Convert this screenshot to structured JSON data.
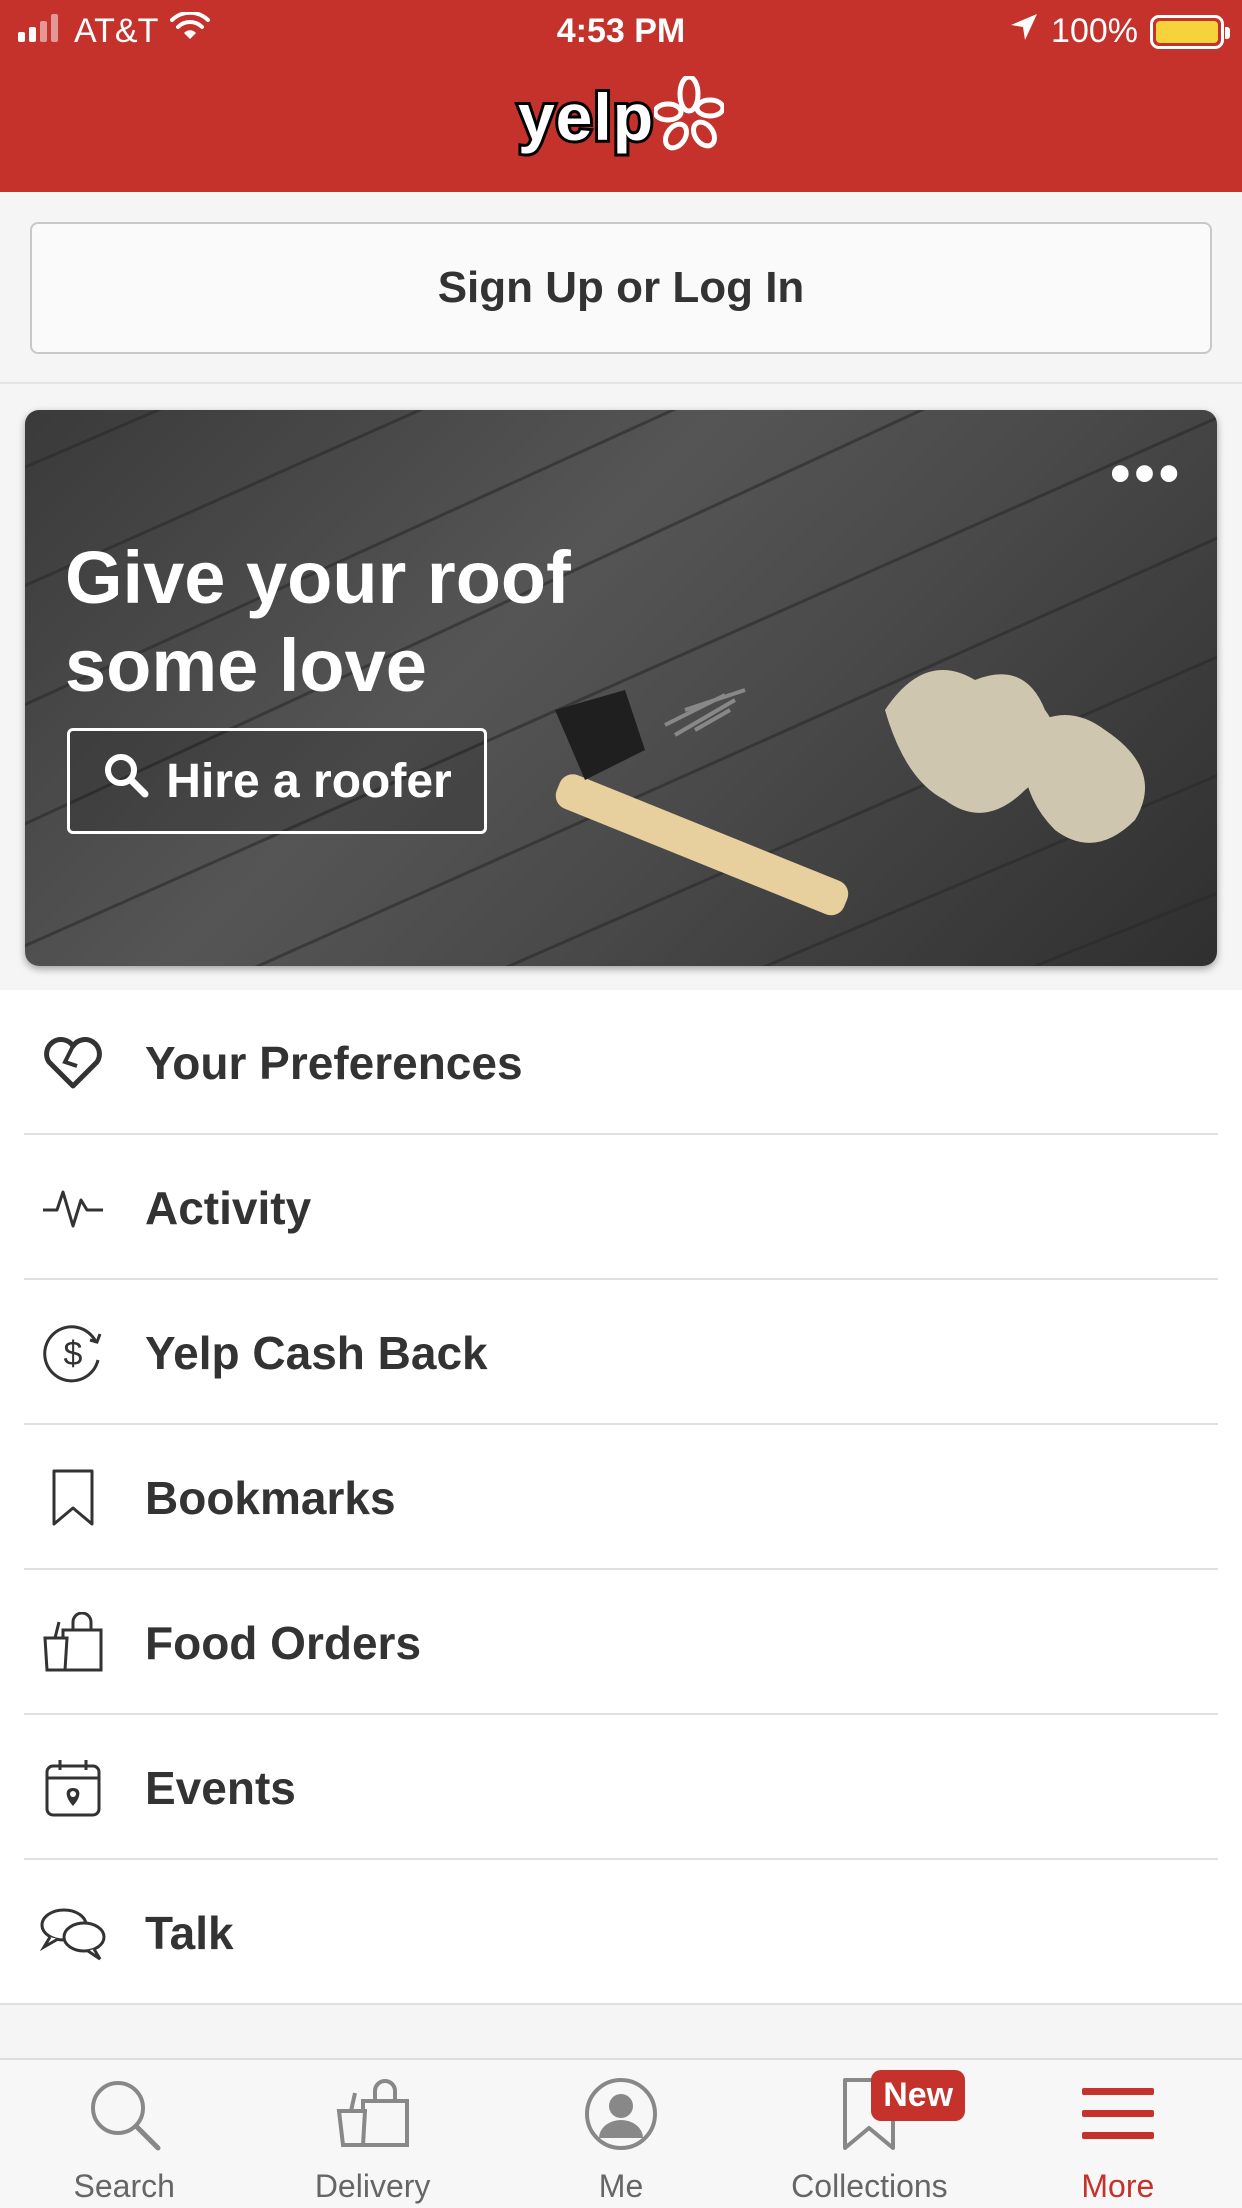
{
  "status_bar": {
    "carrier": "AT&T",
    "time": "4:53 PM",
    "battery": "100%"
  },
  "header": {
    "logo_text": "yelp"
  },
  "signup": {
    "label": "Sign Up or Log In"
  },
  "hero": {
    "title": "Give your roof some love",
    "button_label": "Hire a roofer",
    "more_label": "•••"
  },
  "menu": {
    "items": [
      {
        "label": "Your Preferences",
        "icon": "heart-icon"
      },
      {
        "label": "Activity",
        "icon": "pulse-icon"
      },
      {
        "label": "Yelp Cash Back",
        "icon": "cash-back-icon"
      },
      {
        "label": "Bookmarks",
        "icon": "bookmark-icon"
      },
      {
        "label": "Food Orders",
        "icon": "food-bag-icon"
      },
      {
        "label": "Events",
        "icon": "calendar-icon"
      },
      {
        "label": "Talk",
        "icon": "chat-bubbles-icon"
      }
    ]
  },
  "tabbar": {
    "tabs": [
      {
        "label": "Search",
        "icon": "search-icon"
      },
      {
        "label": "Delivery",
        "icon": "delivery-bag-icon"
      },
      {
        "label": "Me",
        "icon": "profile-icon"
      },
      {
        "label": "Collections",
        "icon": "bookmark-icon",
        "badge": "New"
      },
      {
        "label": "More",
        "icon": "hamburger-icon"
      }
    ],
    "active": "More"
  },
  "colors": {
    "brand_red": "#c4322b",
    "battery_yellow": "#f7d33b"
  }
}
